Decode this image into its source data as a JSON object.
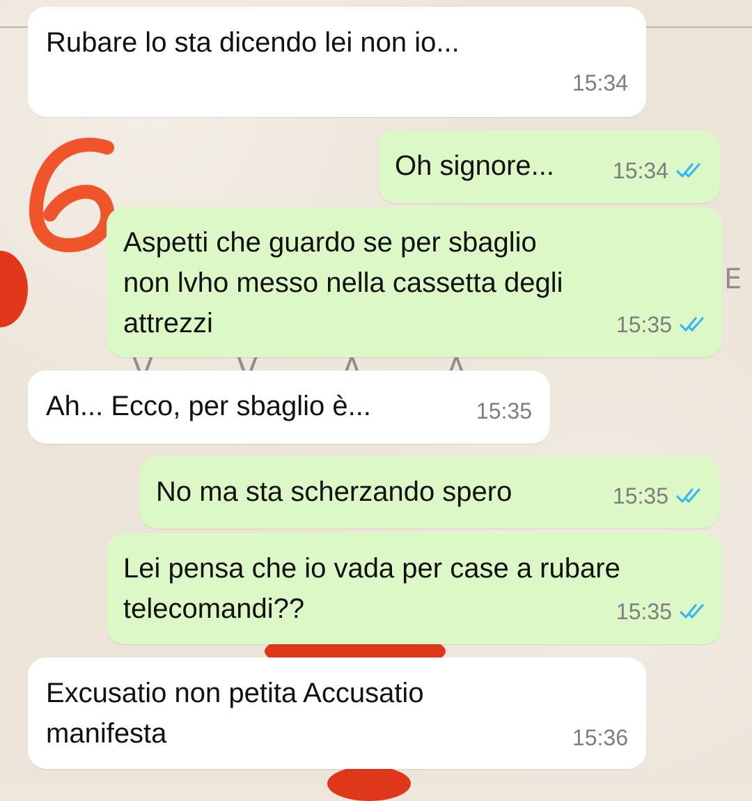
{
  "colors": {
    "incoming_bubble": "#ffffff",
    "outgoing_bubble": "#dcf8c6",
    "timestamp": "#7d7d7d",
    "read_ticks": "#34b7f1",
    "annotation": "#f0542a"
  },
  "annotation": {
    "label": "6"
  },
  "messages": [
    {
      "direction": "incoming",
      "lines": [
        "Rubare lo sta dicendo lei non io..."
      ],
      "time": "15:34"
    },
    {
      "direction": "outgoing",
      "lines": [
        "Oh signore..."
      ],
      "time": "15:34",
      "status_icon": "double-check-icon"
    },
    {
      "direction": "outgoing",
      "lines": [
        "Aspetti che guardo se per sbaglio",
        "non lvho messo nella cassetta degli",
        "attrezzi"
      ],
      "time": "15:35",
      "status_icon": "double-check-icon"
    },
    {
      "direction": "incoming",
      "lines": [
        "Ah... Ecco, per sbaglio è..."
      ],
      "time": "15:35"
    },
    {
      "direction": "outgoing",
      "lines": [
        "No ma sta scherzando spero"
      ],
      "time": "15:35",
      "status_icon": "double-check-icon"
    },
    {
      "direction": "outgoing",
      "lines": [
        "Lei pensa che io vada per case a rubare",
        "telecomandi??"
      ],
      "time": "15:35",
      "status_icon": "double-check-icon"
    },
    {
      "direction": "incoming",
      "lines": [
        "Excusatio non petita Accusatio",
        "manifesta"
      ],
      "time": "15:36"
    }
  ]
}
